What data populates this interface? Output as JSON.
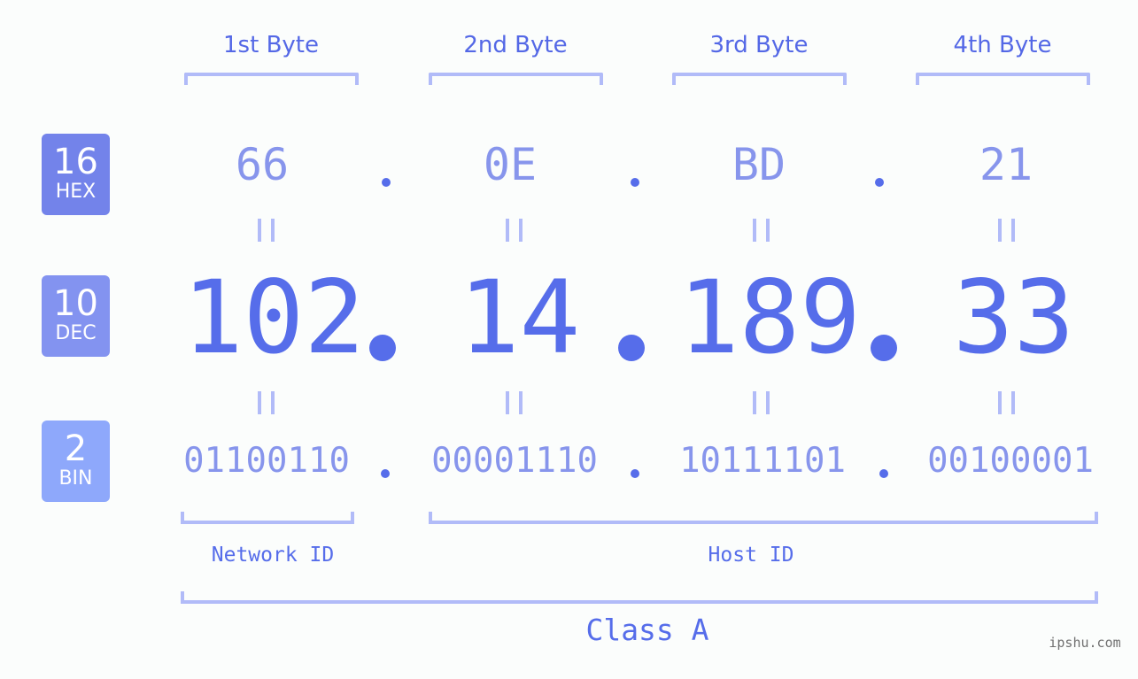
{
  "bytes": {
    "headers": [
      "1st Byte",
      "2nd Byte",
      "3rd Byte",
      "4th Byte"
    ]
  },
  "badges": {
    "hex": {
      "number": "16",
      "label": "HEX",
      "color": "#7383ea"
    },
    "dec": {
      "number": "10",
      "label": "DEC",
      "color": "#8393f0"
    },
    "bin": {
      "number": "2",
      "label": "BIN",
      "color": "#8ea8fb"
    }
  },
  "address": {
    "hex": [
      "66",
      "0E",
      "BD",
      "21"
    ],
    "dec": [
      "102",
      "14",
      "189",
      "33"
    ],
    "bin": [
      "01100110",
      "00001110",
      "10111101",
      "00100001"
    ],
    "separator": "."
  },
  "segments": {
    "network_id": "Network ID",
    "host_id": "Host ID",
    "class": "Class A"
  },
  "colors": {
    "accent": "#566dea",
    "bracket": "#b1bbf8",
    "value_light": "#8795ec",
    "background": "#fbfdfc"
  },
  "watermark": "ipshu.com"
}
